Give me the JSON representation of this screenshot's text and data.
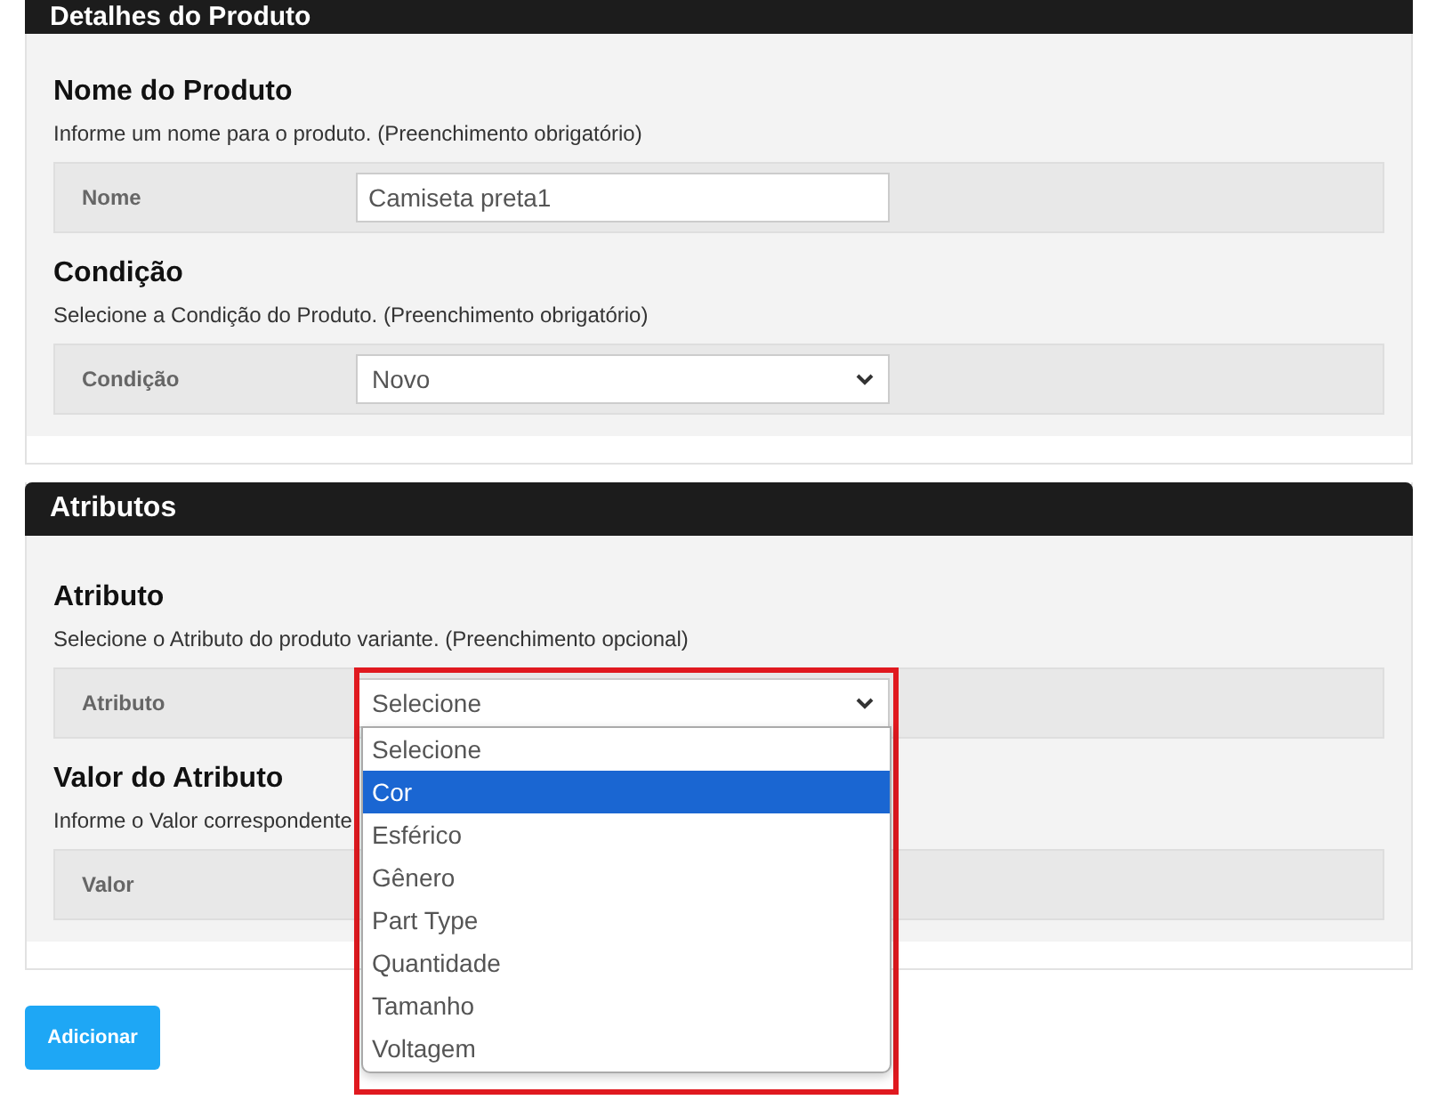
{
  "cards": [
    {
      "title": "Detalhes do Produto",
      "fields": [
        {
          "heading": "Nome do Produto",
          "hint": "Informe um nome para o produto. (Preenchimento obrigatório)",
          "label": "Nome",
          "kind": "text",
          "value": "Camiseta preta1"
        },
        {
          "heading": "Condição",
          "hint": "Selecione a Condição do Produto. (Preenchimento obrigatório)",
          "label": "Condição",
          "kind": "select",
          "value": "Novo"
        }
      ]
    },
    {
      "title": "Atributos",
      "fields": [
        {
          "heading": "Atributo",
          "hint": "Selecione o Atributo do produto variante. (Preenchimento opcional)",
          "label": "Atributo",
          "kind": "select",
          "value": "Selecione",
          "expanded": true,
          "options": [
            {
              "label": "Selecione",
              "highlighted": false
            },
            {
              "label": "Cor",
              "highlighted": true
            },
            {
              "label": "Esférico",
              "highlighted": false
            },
            {
              "label": "Gênero",
              "highlighted": false
            },
            {
              "label": "Part Type",
              "highlighted": false
            },
            {
              "label": "Quantidade",
              "highlighted": false
            },
            {
              "label": "Tamanho",
              "highlighted": false
            },
            {
              "label": "Voltagem",
              "highlighted": false
            }
          ]
        },
        {
          "heading": "Valor do Atributo",
          "hint": "Informe o Valor correspondente",
          "label": "Valor",
          "kind": "hidden"
        }
      ]
    }
  ],
  "button": "Adicionar"
}
